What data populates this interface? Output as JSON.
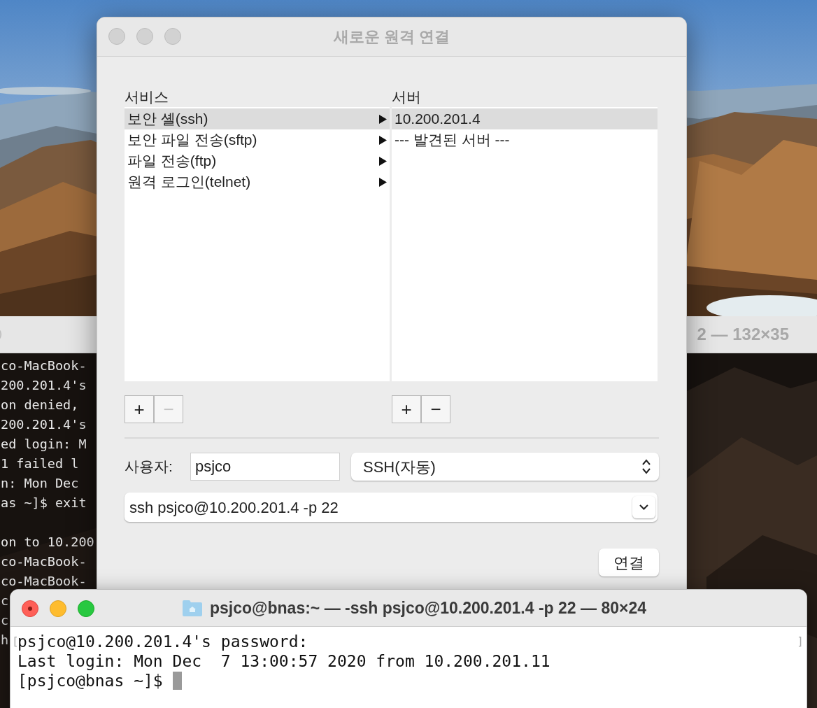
{
  "background_terminal": {
    "title": "2 — 132×35",
    "blocks": [
      [
        "co-MacBook-",
        "200.201.4's",
        "on denied,",
        "200.201.4's",
        "ed login: M",
        "1 failed l",
        "n: Mon Dec",
        "as ~]$ exit"
      ],
      [
        "on to 10.200",
        "co-MacBook-",
        "co-MacBook-",
        "c",
        "c",
        "h"
      ]
    ]
  },
  "dialog": {
    "title": "새로운 원격 연결",
    "services": {
      "label": "서비스",
      "items": [
        {
          "label": "보안 셸(ssh)",
          "selected": true
        },
        {
          "label": "보안 파일 전송(sftp)",
          "selected": false
        },
        {
          "label": "파일 전송(ftp)",
          "selected": false
        },
        {
          "label": "원격 로그인(telnet)",
          "selected": false
        }
      ],
      "add": {
        "label": "+",
        "disabled": false
      },
      "remove": {
        "label": "−",
        "disabled": true
      }
    },
    "servers": {
      "label": "서버",
      "items": [
        {
          "label": "10.200.201.4",
          "selected": true
        },
        {
          "label": "--- 발견된 서버 ---",
          "selected": false
        }
      ],
      "add": {
        "label": "+",
        "disabled": false
      },
      "remove": {
        "label": "−",
        "disabled": false
      }
    },
    "user": {
      "label": "사용자:",
      "value": "psjco"
    },
    "protocol": {
      "value": "SSH(자동)"
    },
    "command": {
      "value": "ssh psjco@10.200.201.4 -p 22"
    },
    "connect_button": "연결"
  },
  "terminal": {
    "title": "psjco@bnas:~ — -ssh psjco@10.200.201.4 -p 22 — 80×24",
    "left_mark": "[",
    "right_mark": "]",
    "lines": [
      "psjco@10.200.201.4's password:",
      "Last login: Mon Dec  7 13:00:57 2020 from 10.200.201.11"
    ],
    "prompt": "[psjco@bnas ~]$"
  }
}
